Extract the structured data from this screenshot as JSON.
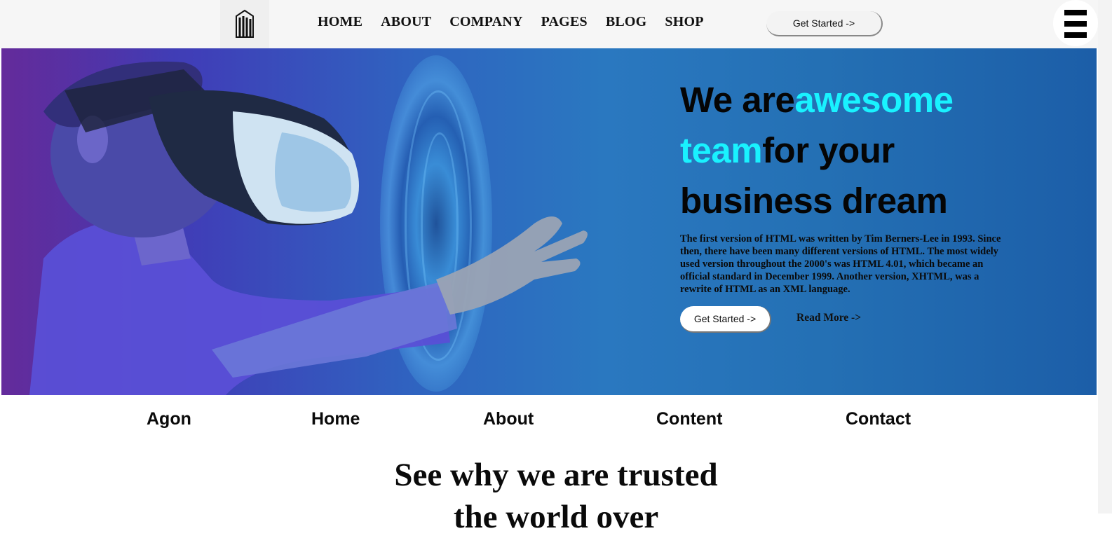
{
  "header": {
    "nav": [
      "HOME",
      "ABOUT",
      "COMPANY",
      "PAGES",
      "BLOG",
      "SHOP"
    ],
    "cta_label": "Get Started ->",
    "logo_icon": "building-logo-icon",
    "menu_icon": "hamburger-menu-icon"
  },
  "hero": {
    "title_part1": "We are",
    "title_accent1": "awesome team",
    "title_part2": "for your business dream",
    "title_line1_a": "We are",
    "title_line1_b": "awesome",
    "title_line2_a": "team",
    "title_line2_b": "for your",
    "title_line3": "business dream",
    "body": "The first version of HTML was written by Tim Berners-Lee in 1993. Since then, there have been many different versions of HTML. The most widely used version throughout the 2000's was HTML 4.01, which became an official standard in December 1999. Another version, XHTML, was a rewrite of HTML as an XML language.",
    "cta_label": "Get Started ->",
    "read_more_label": "Read More ->",
    "accent_color": "#19f2ff"
  },
  "subnav": [
    "Agon",
    "Home",
    "About",
    "Content",
    "Contact"
  ],
  "section": {
    "title_line1": "See why we are trusted",
    "title_line2": "the world over"
  }
}
